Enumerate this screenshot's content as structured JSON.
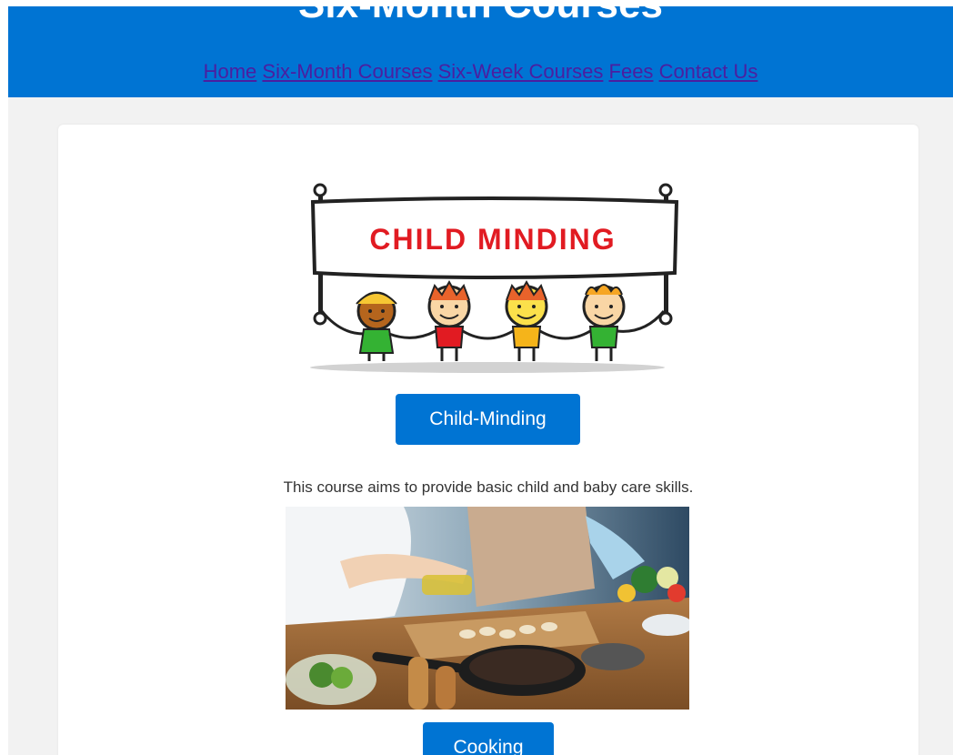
{
  "header": {
    "title": "Six-Month Courses",
    "bg_color": "#0074d3",
    "nav": [
      "Home",
      "Six-Month Courses",
      "Six-Week Courses",
      "Fees",
      "Contact Us"
    ]
  },
  "courses": [
    {
      "image_banner_text": "CHILD MINDING",
      "button_label": "Child-Minding",
      "description": "This course aims to provide basic child and baby care skills."
    },
    {
      "button_label": "Cooking"
    }
  ]
}
